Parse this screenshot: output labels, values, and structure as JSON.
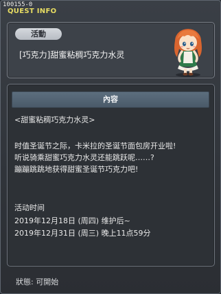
{
  "window": {
    "quest_id": "100155-0",
    "title": "QUEST INFO"
  },
  "header": {
    "category_badge": "活動",
    "quest_title": "[巧克力]甜蜜粘稠巧克力水灵"
  },
  "content": {
    "section_title": "內容",
    "lines": [
      "<甜蜜粘稠巧克力水灵>",
      "时值圣诞节之际，卡米拉的圣诞节面包房开业啦!",
      "听说骑乘甜蜜巧克力水灵还能跳跃呢……?",
      "蹦蹦跳跳地获得甜蜜圣诞节巧克力吧!",
      "活动时间",
      "2019年12月18日 (周四) 维护后~",
      "2019年12月31日 (周三) 晚上11点59分"
    ]
  },
  "status": {
    "text": "狀態:  可開始"
  },
  "colors": {
    "title_accent": "#e8dd62",
    "npc_hair": "#e0733a",
    "npc_dress": "#2f7a4a"
  }
}
